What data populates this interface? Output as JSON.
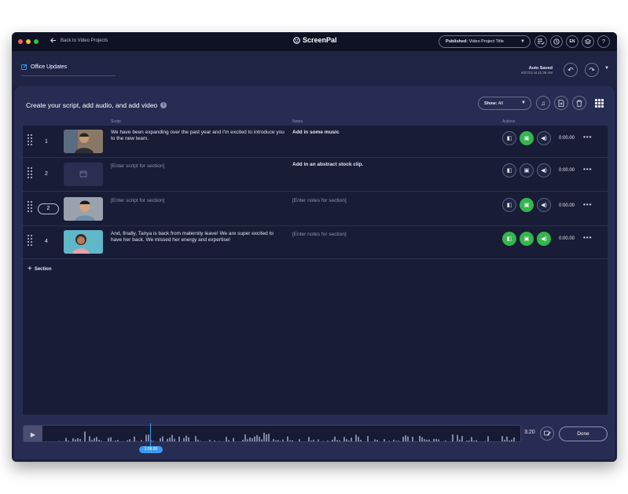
{
  "titlebar": {
    "back_label": "Back to Video Projects",
    "brand": "ScreenPal",
    "published_prefix": "Published:",
    "published_title": "Video Project Title",
    "lang": "EN"
  },
  "subbar": {
    "project_title": "Office Updates",
    "autosave_label": "Auto Saved",
    "autosave_time": "9/27/22 at 11:38 AM"
  },
  "panel": {
    "heading": "Create your script, add audio, and add video",
    "show_prefix": "Show:",
    "show_value": "All",
    "columns": {
      "script": "Script",
      "notes": "Notes",
      "actions": "Actions"
    }
  },
  "rows": [
    {
      "num": "1",
      "script": "We have been expanding over the past year and I'm excited to introduce you to the new team.",
      "notes": "Add in some music",
      "duration": "0:00.00",
      "actions_on": [
        false,
        true,
        false
      ]
    },
    {
      "num": "2",
      "script": "[Enter script for section]",
      "notes": "Add in an abstract stock clip.",
      "duration": "0:00.00",
      "actions_on": [
        false,
        false,
        false
      ]
    },
    {
      "num": "2",
      "script": "[Enter script for section]",
      "notes": "[Enter notes for section]",
      "duration": "0:00.00",
      "actions_on": [
        false,
        true,
        false
      ]
    },
    {
      "num": "4",
      "script": "And, finally, Tanya is back from maternity leave! We are super excited to have her back. We missed her energy and expertise!",
      "notes": "[Enter notes for section]",
      "duration": "0:00.00",
      "actions_on": [
        true,
        true,
        true
      ]
    }
  ],
  "add_section_label": "Section",
  "timeline": {
    "current_time": "1:08.00",
    "total_time": "3:20",
    "done_label": "Done"
  },
  "colors": {
    "accent_green": "#35b54d",
    "accent_blue": "#3b9bf0",
    "background": "#1d2140"
  },
  "icons": [
    "back-arrow-icon",
    "edit-icon",
    "undo-icon",
    "redo-icon",
    "music-icon",
    "add-file-icon",
    "trash-icon",
    "grid-icon",
    "play-icon"
  ]
}
